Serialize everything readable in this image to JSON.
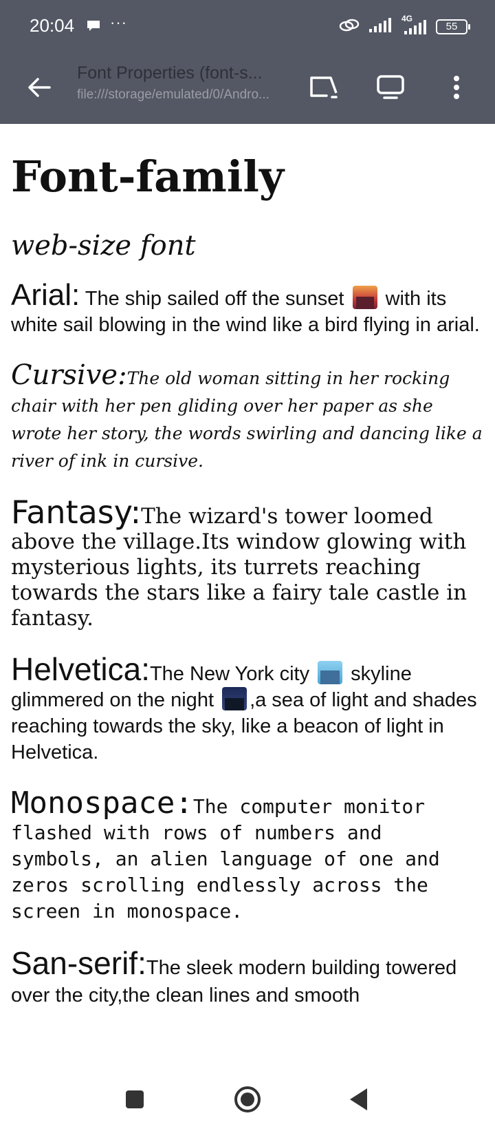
{
  "status_bar": {
    "time": "20:04",
    "dots": "···",
    "network": "4G",
    "battery": "55",
    "icons": [
      "message-icon",
      "link-icon",
      "signal-icon",
      "signal-4g-icon",
      "battery-icon"
    ]
  },
  "app_bar": {
    "title": "Font Properties (font-s...",
    "url": "file:///storage/emulated/0/Andro...",
    "icons": [
      "back-arrow-icon",
      "cast-icon",
      "desktop-icon",
      "more-vert-icon"
    ]
  },
  "content": {
    "heading": "Font-family",
    "subtitle": "web-size font",
    "arial": {
      "label": "Arial:",
      "text_a": " The ship sailed off the sunset ",
      "text_b": " with its white sail blowing in the wind like a bird flying in arial."
    },
    "cursive": {
      "label": "Cursive:",
      "text": "The old woman sitting in her rocking chair with her pen gliding over her paper as she wrote her story, the words swirling and dancing like a river of ink in cursive."
    },
    "fantasy": {
      "label": "Fantasy:",
      "text": "The wizard's tower loomed above the village.Its window glowing with mysterious lights, its turrets reaching towards the stars like a fairy tale castle in fantasy."
    },
    "helvetica": {
      "label": "Helvetica:",
      "text_a": "The New York city ",
      "text_b": " skyline glimmered on the night ",
      "text_c": ",a sea of light and shades reaching towards the sky, like a beacon of light in Helvetica."
    },
    "monospace": {
      "label": "Monospace:",
      "text": "The computer monitor flashed with rows of numbers and symbols, an alien language of one and zeros scrolling endlessly across the screen in monospace."
    },
    "sansserif": {
      "label": "San-serif:",
      "text": "The sleek modern building towered over the city,the clean lines and smooth"
    }
  },
  "nav_bar": {
    "icons": [
      "recents-square-icon",
      "home-circle-icon",
      "back-triangle-icon"
    ]
  },
  "colors": {
    "header_bg": "#545864",
    "title_text": "#2e3038",
    "url_text": "#9a9da6",
    "nav_icon": "#333333"
  }
}
